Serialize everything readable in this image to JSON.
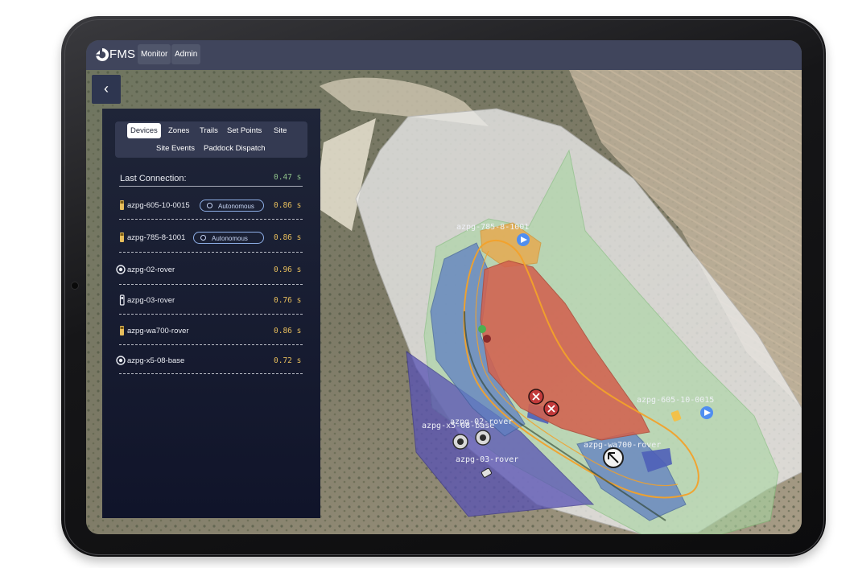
{
  "app": {
    "brand": "FMS",
    "nav": [
      "Monitor",
      "Admin"
    ]
  },
  "panel": {
    "back_icon": "chevron-left-icon",
    "tabs_row1": [
      "Devices",
      "Zones",
      "Trails",
      "Set Points",
      "Site"
    ],
    "tabs_row2": [
      "Site Events",
      "Paddock Dispatch"
    ],
    "last_connection_label": "Last Connection:",
    "last_connection_value": "0.47 s",
    "devices": [
      {
        "name": "azpg-605-10-0015",
        "icon": "truck-icon",
        "badge": "Autonomous",
        "latency": "0.86 s"
      },
      {
        "name": "azpg-785-8-1001",
        "icon": "truck-icon",
        "badge": "Autonomous",
        "latency": "0.86 s"
      },
      {
        "name": "azpg-02-rover",
        "icon": "rover-icon",
        "badge": "",
        "latency": "0.96 s"
      },
      {
        "name": "azpg-03-rover",
        "icon": "handheld-icon",
        "badge": "",
        "latency": "0.76 s"
      },
      {
        "name": "azpg-wa700-rover",
        "icon": "truck-icon",
        "badge": "",
        "latency": "0.86 s"
      },
      {
        "name": "azpg-x5-08-base",
        "icon": "rover-icon",
        "badge": "",
        "latency": "0.72 s"
      }
    ]
  },
  "map": {
    "labels": {
      "truck_a": "azpg-785-8-1001",
      "truck_b": "azpg-605-10-0015",
      "base": "azpg-x5-08-base",
      "rover2": "azpg-02-rover",
      "wa700": "azpg-wa700-rover",
      "rover3": "azpg-03-rover"
    },
    "colors": {
      "zone_red": "#d2624f",
      "zone_blue": "#5f7fc2",
      "zone_purple": "#5852b5",
      "zone_green": "#a8d6a2",
      "zone_white": "#ececec",
      "trail_orange": "#f2a12a",
      "accent_blue": "#4f8ef0"
    }
  }
}
